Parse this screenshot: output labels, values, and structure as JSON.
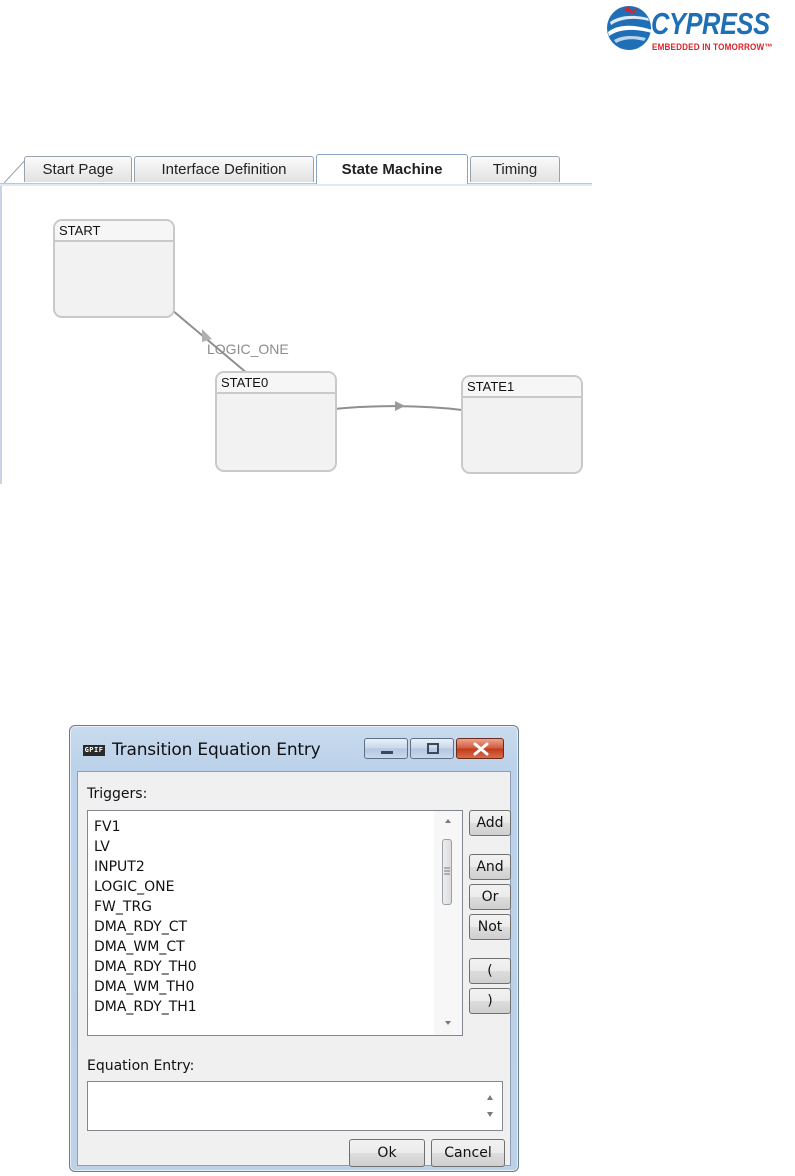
{
  "logo": {
    "brand": "CYPRESS",
    "tagline": "EMBEDDED IN TOMORROW™"
  },
  "editor": {
    "tabs": [
      {
        "label": "Start Page",
        "active": false
      },
      {
        "label": "Interface Definition",
        "active": false
      },
      {
        "label": "State Machine",
        "active": true
      },
      {
        "label": "Timing",
        "active": false
      }
    ],
    "states": [
      {
        "name": "START"
      },
      {
        "name": "STATE0"
      },
      {
        "name": "STATE1"
      }
    ],
    "transitions": [
      {
        "from": "START",
        "to": "STATE0",
        "label": "LOGIC_ONE"
      },
      {
        "from": "STATE0",
        "to": "STATE1",
        "label": ""
      }
    ]
  },
  "dialog": {
    "icon_text": "GPIF",
    "title": "Transition Equation Entry",
    "triggers_label": "Triggers:",
    "triggers": [
      "FV1",
      "LV",
      "INPUT2",
      "LOGIC_ONE",
      "FW_TRG",
      "DMA_RDY_CT",
      "DMA_WM_CT",
      "DMA_RDY_TH0",
      "DMA_WM_TH0",
      "DMA_RDY_TH1"
    ],
    "buttons": {
      "add": "Add",
      "and": "And",
      "or": "Or",
      "not": "Not",
      "open_paren": "(",
      "close_paren": ")",
      "ok": "Ok",
      "cancel": "Cancel"
    },
    "equation_label": "Equation Entry:",
    "equation_value": ""
  },
  "colors": {
    "brand_blue": "#1f6fb7",
    "brand_red": "#d8232a",
    "state_border": "#c9c9c9",
    "close_button": "#c1391a"
  }
}
